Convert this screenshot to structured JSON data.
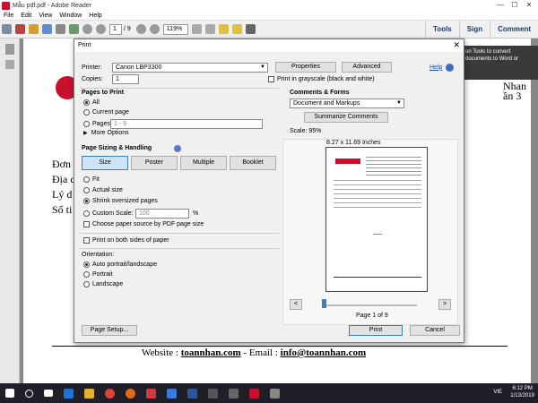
{
  "window": {
    "title": "Mẫu pdf.pdf - Adobe Reader",
    "min": "—",
    "max": "☐",
    "close": "✕"
  },
  "menu": [
    "File",
    "Edit",
    "View",
    "Window",
    "Help"
  ],
  "toolbar": {
    "page_current": "1",
    "page_total": "/ 9",
    "zoom": "119%"
  },
  "rightnav": {
    "tools": "Tools",
    "sign": "Sign",
    "comment": "Comment"
  },
  "notice": "on Tools to convert documents to Word or",
  "document": {
    "lines": [
      "Nhan",
      "ần 3",
      "Đơn",
      "Địa c",
      "Lý d",
      "Số ti"
    ],
    "footer_prefix": "Website : ",
    "footer_site": "toannhan.com",
    "footer_mid": " - Email : ",
    "footer_email": "info@toannhan.com"
  },
  "dialog": {
    "title": "Print",
    "close": "✕",
    "printer_label": "Printer:",
    "printer_value": "Canon LBP3300",
    "properties": "Properties",
    "advanced": "Advanced",
    "help": "Help",
    "copies_label": "Copies:",
    "copies_value": "1",
    "grayscale": "Print in grayscale (black and white)",
    "pages_to_print": "Pages to Print",
    "opt_all": "All",
    "opt_current": "Current page",
    "opt_pages": "Pages",
    "pages_value": "1 - 9",
    "more_options": "More Options",
    "sizing_title": "Page Sizing & Handling",
    "tab_size": "Size",
    "tab_poster": "Poster",
    "tab_multiple": "Multiple",
    "tab_booklet": "Booklet",
    "opt_fit": "Fit",
    "opt_actual": "Actual size",
    "opt_shrink": "Shrink oversized pages",
    "opt_custom": "Custom Scale:",
    "custom_value": "100",
    "custom_unit": "%",
    "choose_source": "Choose paper source by PDF page size",
    "both_sides": "Print on both sides of paper",
    "orientation_label": "Orientation:",
    "opt_auto": "Auto portrait/landscape",
    "opt_portrait": "Portrait",
    "opt_landscape": "Landscape",
    "comments_title": "Comments & Forms",
    "comments_value": "Document and Markups",
    "summarize": "Summarize Comments",
    "scale": "Scale: 95%",
    "paper_size": "8.27 x 11.69 Inches",
    "page_of": "Page 1 of 9",
    "page_setup": "Page Setup...",
    "print": "Print",
    "cancel": "Cancel"
  },
  "taskbar": {
    "lang": "VIE",
    "time": "6:12 PM",
    "date": "1/13/2019"
  }
}
